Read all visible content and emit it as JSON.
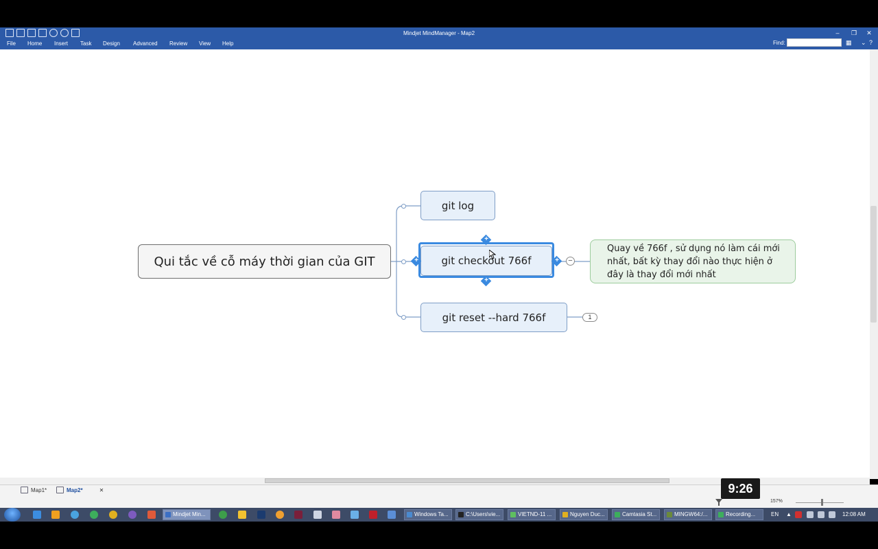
{
  "window": {
    "title": "Mindjet MindManager - Map2"
  },
  "ribbon": {
    "menu": [
      "File",
      "Home",
      "Insert",
      "Task",
      "Design",
      "Advanced",
      "Review",
      "View",
      "Help"
    ],
    "find_label": "Find:",
    "find_value": ""
  },
  "map": {
    "central_topic": "Qui tắc về cỗ máy thời gian của GIT",
    "subtopics": [
      {
        "label": "git log"
      },
      {
        "label": "git checkout 766f",
        "selected": true
      },
      {
        "label": "git reset --hard 766f",
        "collapsed_count": "1"
      }
    ],
    "note": "Quay về 766f , sử dụng nó làm cái mới nhất,  bất kỳ thay đổi nào thực hiện ở đây là thay đổi mới nhất",
    "collapse_symbol": "−"
  },
  "sheet_tabs": [
    "Map1*",
    "Map2*"
  ],
  "status": {
    "zoom": "157%"
  },
  "overlay": {
    "timer": "9:26"
  },
  "taskbar": {
    "items": [
      "Mindjet Min...",
      "Windows Ta...",
      "C:\\Users\\vie...",
      "VIETND-11 ...",
      "Nguyen Duc...",
      "Camtasia St...",
      "MINGW64:/...",
      "Recording..."
    ],
    "language": "EN",
    "clock": "12:08 AM"
  },
  "colors": {
    "titlebar": "#2c5aa8",
    "selection": "#3a8ae0",
    "topic_fill": "#e7f0fa",
    "note_fill": "#e9f4e9"
  }
}
